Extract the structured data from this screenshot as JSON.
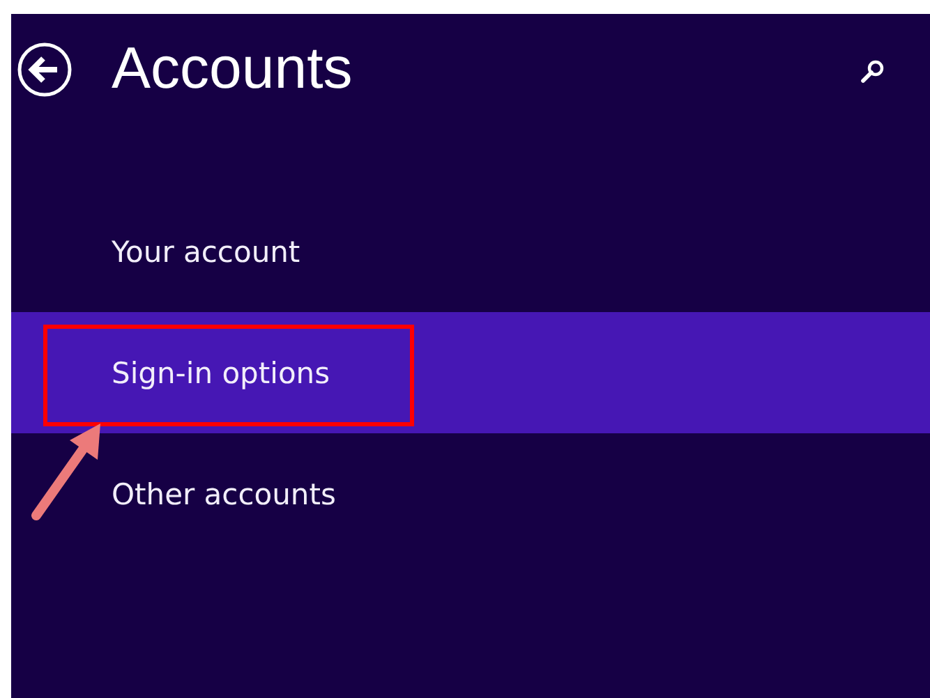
{
  "header": {
    "title": "Accounts"
  },
  "items": [
    {
      "label": "Your account",
      "selected": false,
      "annotated": false
    },
    {
      "label": "Sign-in options",
      "selected": true,
      "annotated": true
    },
    {
      "label": "Other accounts",
      "selected": false,
      "annotated": false
    }
  ]
}
